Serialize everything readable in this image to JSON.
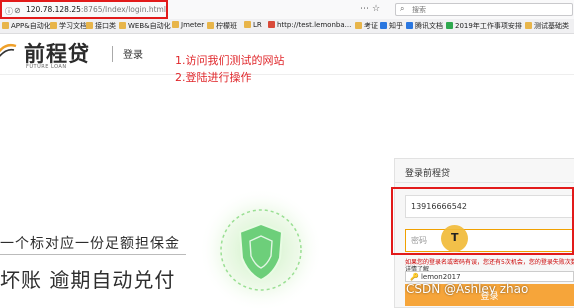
{
  "browser": {
    "url_host": "120.78.128.25",
    "url_path": ":8765/Index/login.html",
    "search_placeholder": "搜索",
    "bookmarks": [
      "APP&自动化",
      "学习文档",
      "接口类",
      "WEB&自动化",
      "Jmeter",
      "柠檬班",
      "LR",
      "http://test.lemonba...",
      "考证",
      "知乎",
      "腾讯文档",
      "2019年工作事项安排",
      "测试基础类"
    ]
  },
  "header": {
    "logo_cn": "前程贷",
    "logo_en": "FUTURE LOAN",
    "login_link": "登录"
  },
  "notes": [
    "1.访问我们测试的网站",
    "2.登陆进行操作"
  ],
  "hero": {
    "slogan1": "一个标对应一份足额担保金",
    "slogan2": "坏账  逾期自动兑付"
  },
  "login_panel": {
    "title": "登录前程贷",
    "phone_value": "13916666542",
    "password_placeholder": "密码",
    "cursor_label": "T",
    "error_tip": "如果您的登录名或密码有误，您还有5次机会，您的登录失败次数已达上限",
    "tip_link": "详情了解",
    "suggestion": "lemon2017",
    "button_label": "登录"
  },
  "watermark": "CSDN @Ashley zhao",
  "colors": {
    "annotation_red": "#e21a1a",
    "brand_orange": "#f6a53a",
    "shield_green": "#6dcf7a"
  }
}
